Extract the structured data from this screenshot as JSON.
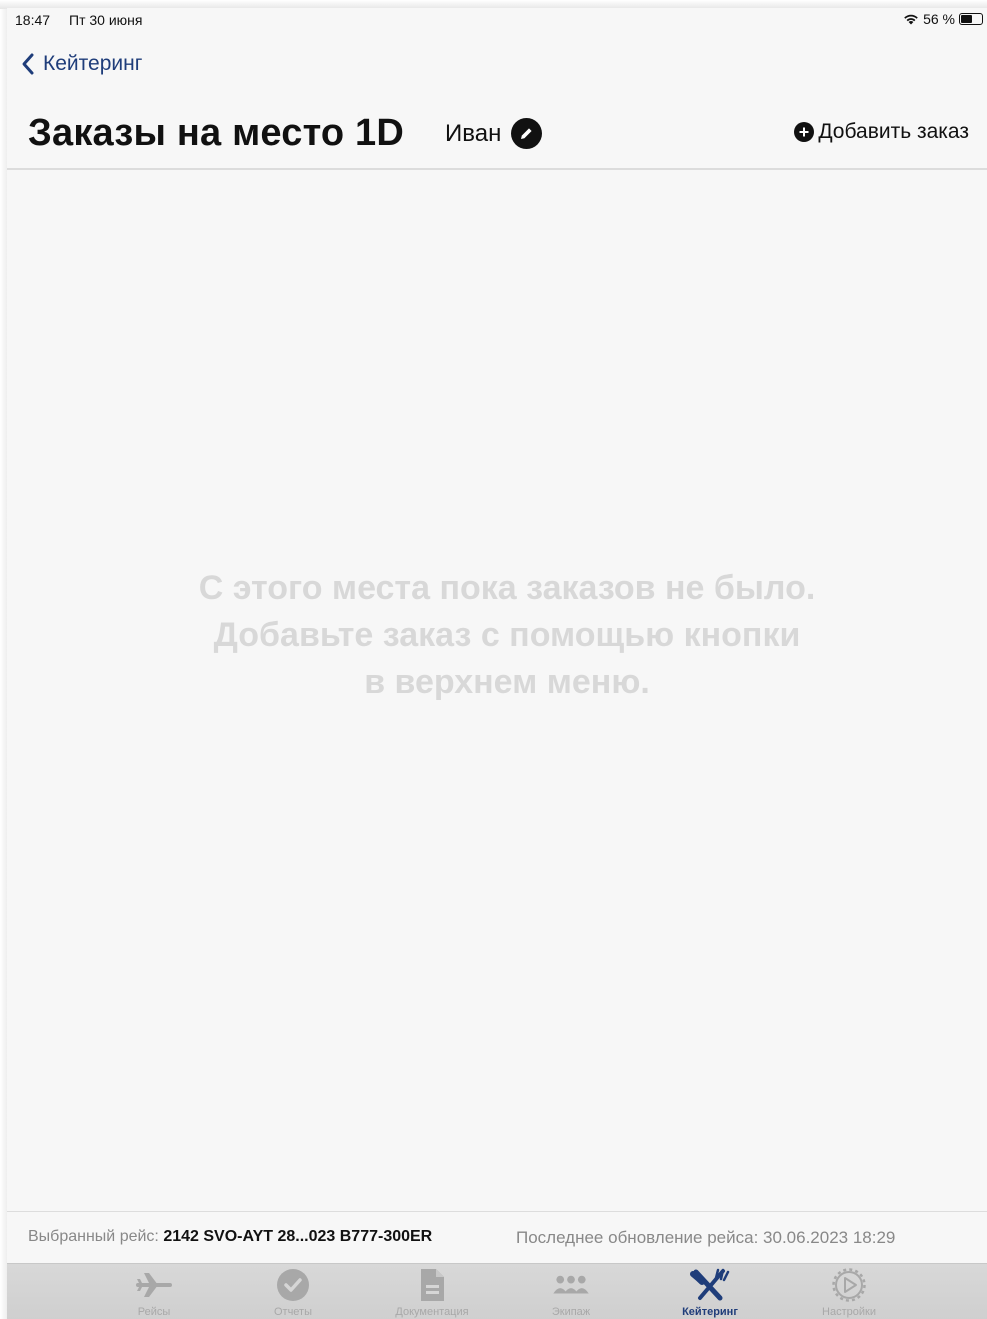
{
  "status_bar": {
    "time": "18:47",
    "date": "Пт 30 июня",
    "battery_percent": "56 %",
    "battery_level": 0.56
  },
  "nav": {
    "back_label": "Кейтеринг"
  },
  "header": {
    "title": "Заказы на место 1D",
    "passenger_name": "Иван",
    "add_order_label": "Добавить заказ"
  },
  "empty_state": {
    "line1": "С этого места пока заказов не было.",
    "line2": "Добавьте заказ с помощью кнопки",
    "line3": "в верхнем меню."
  },
  "footer": {
    "flight_label": "Выбранный рейс:",
    "flight_value": "2142 SVO-AYT 28...023 B777-300ER",
    "update_label": "Последнее обновление рейса: 30.06.2023 18:29"
  },
  "tabs": [
    {
      "label": "Рейсы",
      "icon": "airplane-icon",
      "active": false
    },
    {
      "label": "Отчеты",
      "icon": "checkmark-circle-icon",
      "active": false
    },
    {
      "label": "Документация",
      "icon": "document-icon",
      "active": false
    },
    {
      "label": "Экипаж",
      "icon": "people-icon",
      "active": false
    },
    {
      "label": "Кейтеринг",
      "icon": "fork-knife-icon",
      "active": true
    },
    {
      "label": "Настройки",
      "icon": "gear-icon",
      "active": false
    }
  ],
  "colors": {
    "accent": "#1f3d7a",
    "background": "#f7f7f7",
    "placeholder_text": "#d8d8d8",
    "tab_inactive": "#a8a8a8"
  }
}
